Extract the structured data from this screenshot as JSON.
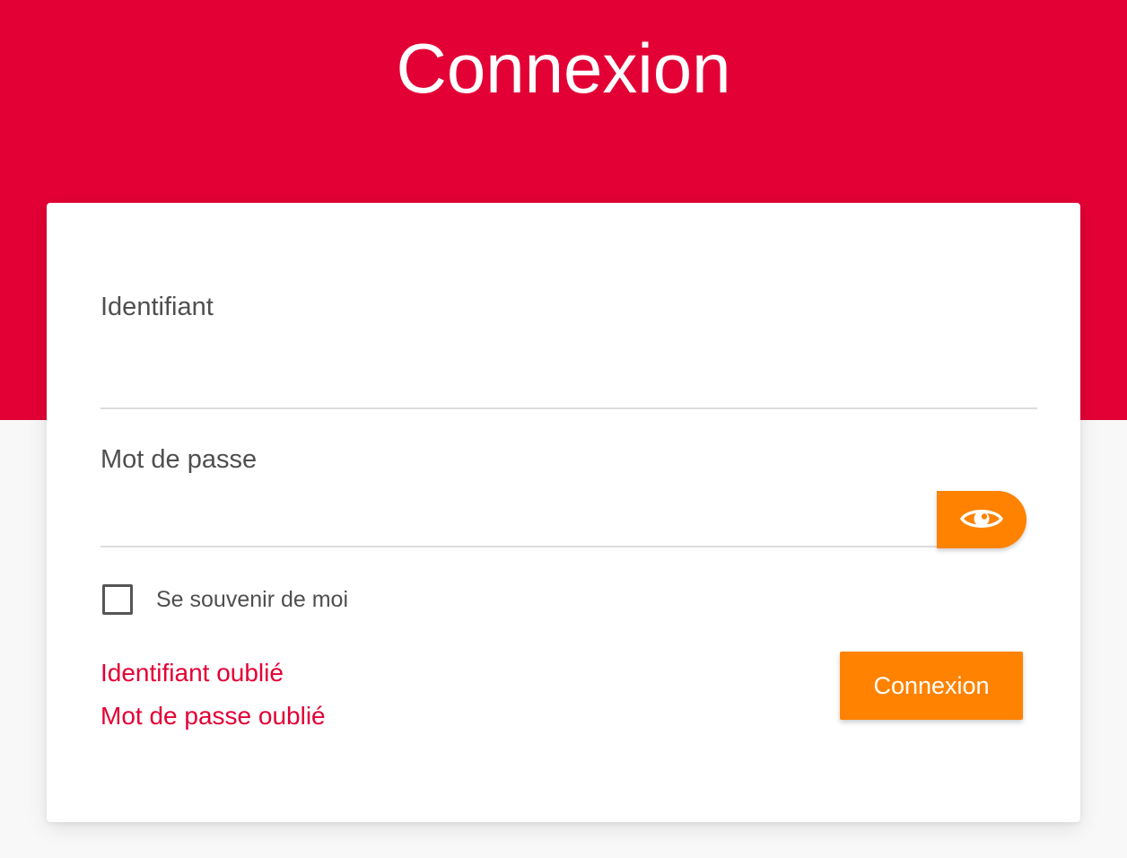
{
  "header": {
    "title": "Connexion",
    "color": "#e30035"
  },
  "form": {
    "username": {
      "label": "Identifiant",
      "value": ""
    },
    "password": {
      "label": "Mot de passe",
      "value": "",
      "toggle_icon": "eye-icon"
    },
    "remember_me": {
      "label": "Se souvenir de moi",
      "checked": false
    },
    "links": {
      "forgot_username": "Identifiant oublié",
      "forgot_password": "Mot de passe oublié"
    },
    "submit_label": "Connexion",
    "accent_color": "#ff8200"
  }
}
